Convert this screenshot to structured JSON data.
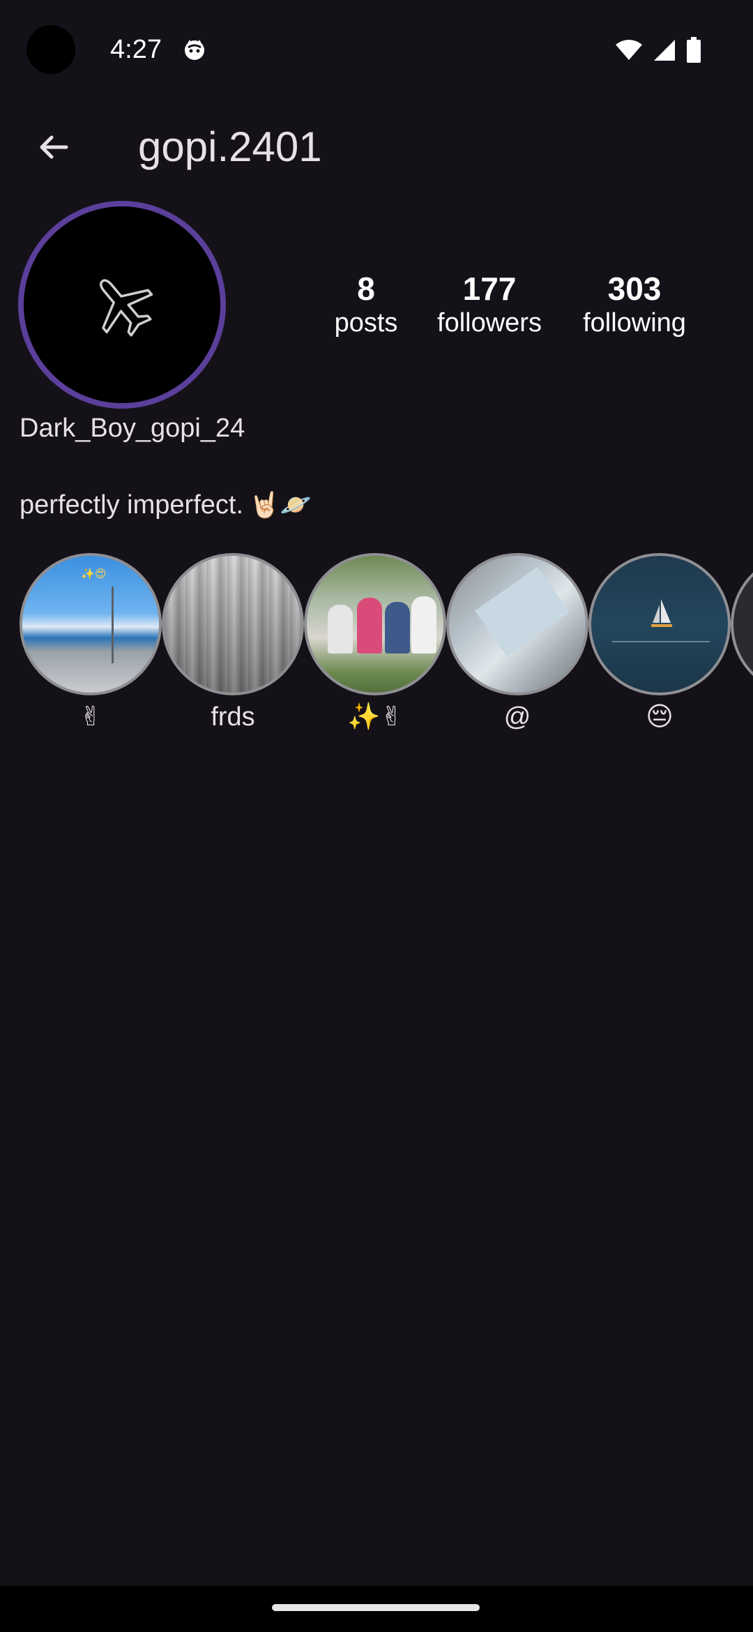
{
  "status_bar": {
    "time": "4:27",
    "notification_icon": "cat-face-icon",
    "right_icons": [
      "wifi-icon",
      "signal-icon",
      "battery-icon"
    ]
  },
  "header": {
    "back_icon": "arrow-left-icon",
    "title": "gopi.2401"
  },
  "profile": {
    "avatar_icon": "airplane-icon",
    "ring_color": "#5b3f9a",
    "display_name": "Dark_Boy_gopi_24",
    "bio": "perfectly imperfect.",
    "bio_emoji": "🤘🏻🪐"
  },
  "stats": [
    {
      "count": "8",
      "label": "posts"
    },
    {
      "count": "177",
      "label": "followers"
    },
    {
      "count": "303",
      "label": "following"
    }
  ],
  "highlights": [
    {
      "label": "✌",
      "icon": "beach-road-image"
    },
    {
      "label": "frds",
      "icon": "gray-texture-image"
    },
    {
      "label": "✨✌",
      "icon": "group-photo-image"
    },
    {
      "label": "@",
      "icon": "laptop-screen-image"
    },
    {
      "label": "😔",
      "icon": "sailboat-image"
    },
    {
      "label": "(",
      "icon": "partial-highlight-image"
    }
  ],
  "colors": {
    "background": "#141218",
    "text": "#e6e0e9",
    "highlight_border": "#8f8f93"
  }
}
